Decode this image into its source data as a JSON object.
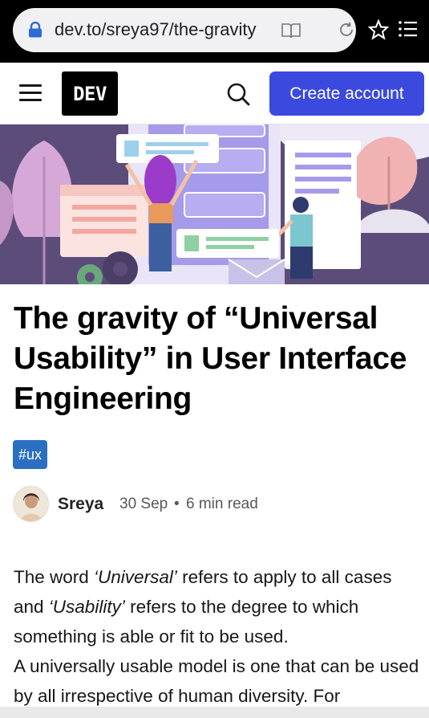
{
  "browser": {
    "url": "dev.to/sreya97/the-gravity",
    "icons": [
      "lock-icon",
      "reader-mode-icon",
      "reload-icon",
      "star-icon",
      "menu-icon"
    ]
  },
  "header": {
    "logo": "DEV",
    "create_account": "Create account",
    "accent": "#3b49df"
  },
  "article": {
    "title": "The gravity of “Universal Usability” in User Interface Engineering",
    "tag": "#ux",
    "author": "Sreya",
    "date": "30 Sep",
    "separator": "•",
    "read_time": "6 min read",
    "p1_a": "The word ",
    "p1_em1": "‘Universal’",
    "p1_b": " refers to apply to all cases and ",
    "p1_em2": "‘Usability’",
    "p1_c": " refers to the degree to which something is able or fit to be used.",
    "p2": "A universally usable model is one that can be used by all irrespective of human diversity. For"
  }
}
